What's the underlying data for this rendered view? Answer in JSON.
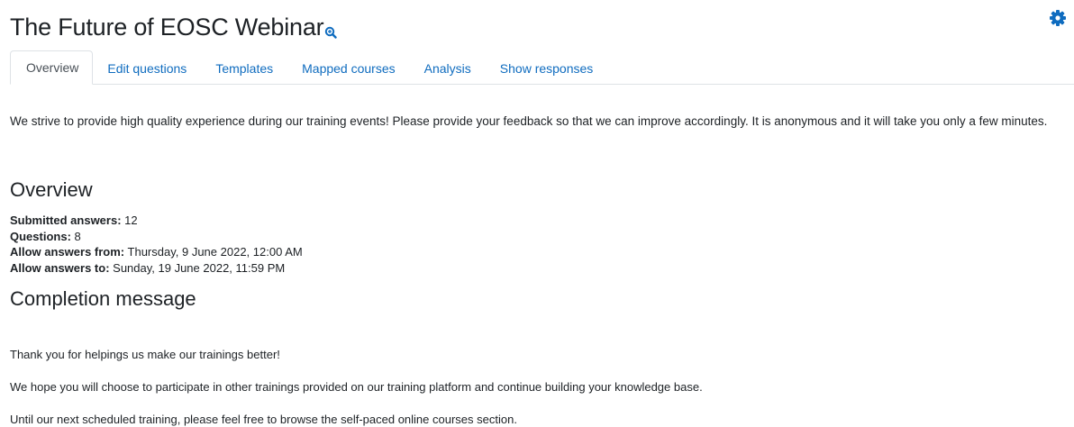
{
  "header": {
    "title": "The Future of EOSC Webinar",
    "title_icon": "search-zoom-icon",
    "settings_icon": "gear-icon",
    "accent_color": "#0f6cbf"
  },
  "tabs": [
    {
      "label": "Overview",
      "active": true
    },
    {
      "label": "Edit questions",
      "active": false
    },
    {
      "label": "Templates",
      "active": false
    },
    {
      "label": "Mapped courses",
      "active": false
    },
    {
      "label": "Analysis",
      "active": false
    },
    {
      "label": "Show responses",
      "active": false
    }
  ],
  "intro": "We strive to provide high quality experience during our training events! Please provide your feedback so that we can improve accordingly. It is anonymous and it will take you only a few minutes.",
  "overview": {
    "heading": "Overview",
    "submitted_label": "Submitted answers:",
    "submitted_value": "12",
    "questions_label": "Questions:",
    "questions_value": "8",
    "from_label": "Allow answers from:",
    "from_value": "Thursday, 9 June 2022, 12:00 AM",
    "to_label": "Allow answers to:",
    "to_value": "Sunday, 19 June 2022, 11:59 PM"
  },
  "completion": {
    "heading": "Completion message",
    "lines": [
      "Thank you for helpings us make our trainings better!",
      "We hope you will choose to participate in other trainings provided on our training platform and continue building your knowledge base.",
      "Until our next scheduled training, please feel free to browse the self-paced online courses section."
    ]
  }
}
